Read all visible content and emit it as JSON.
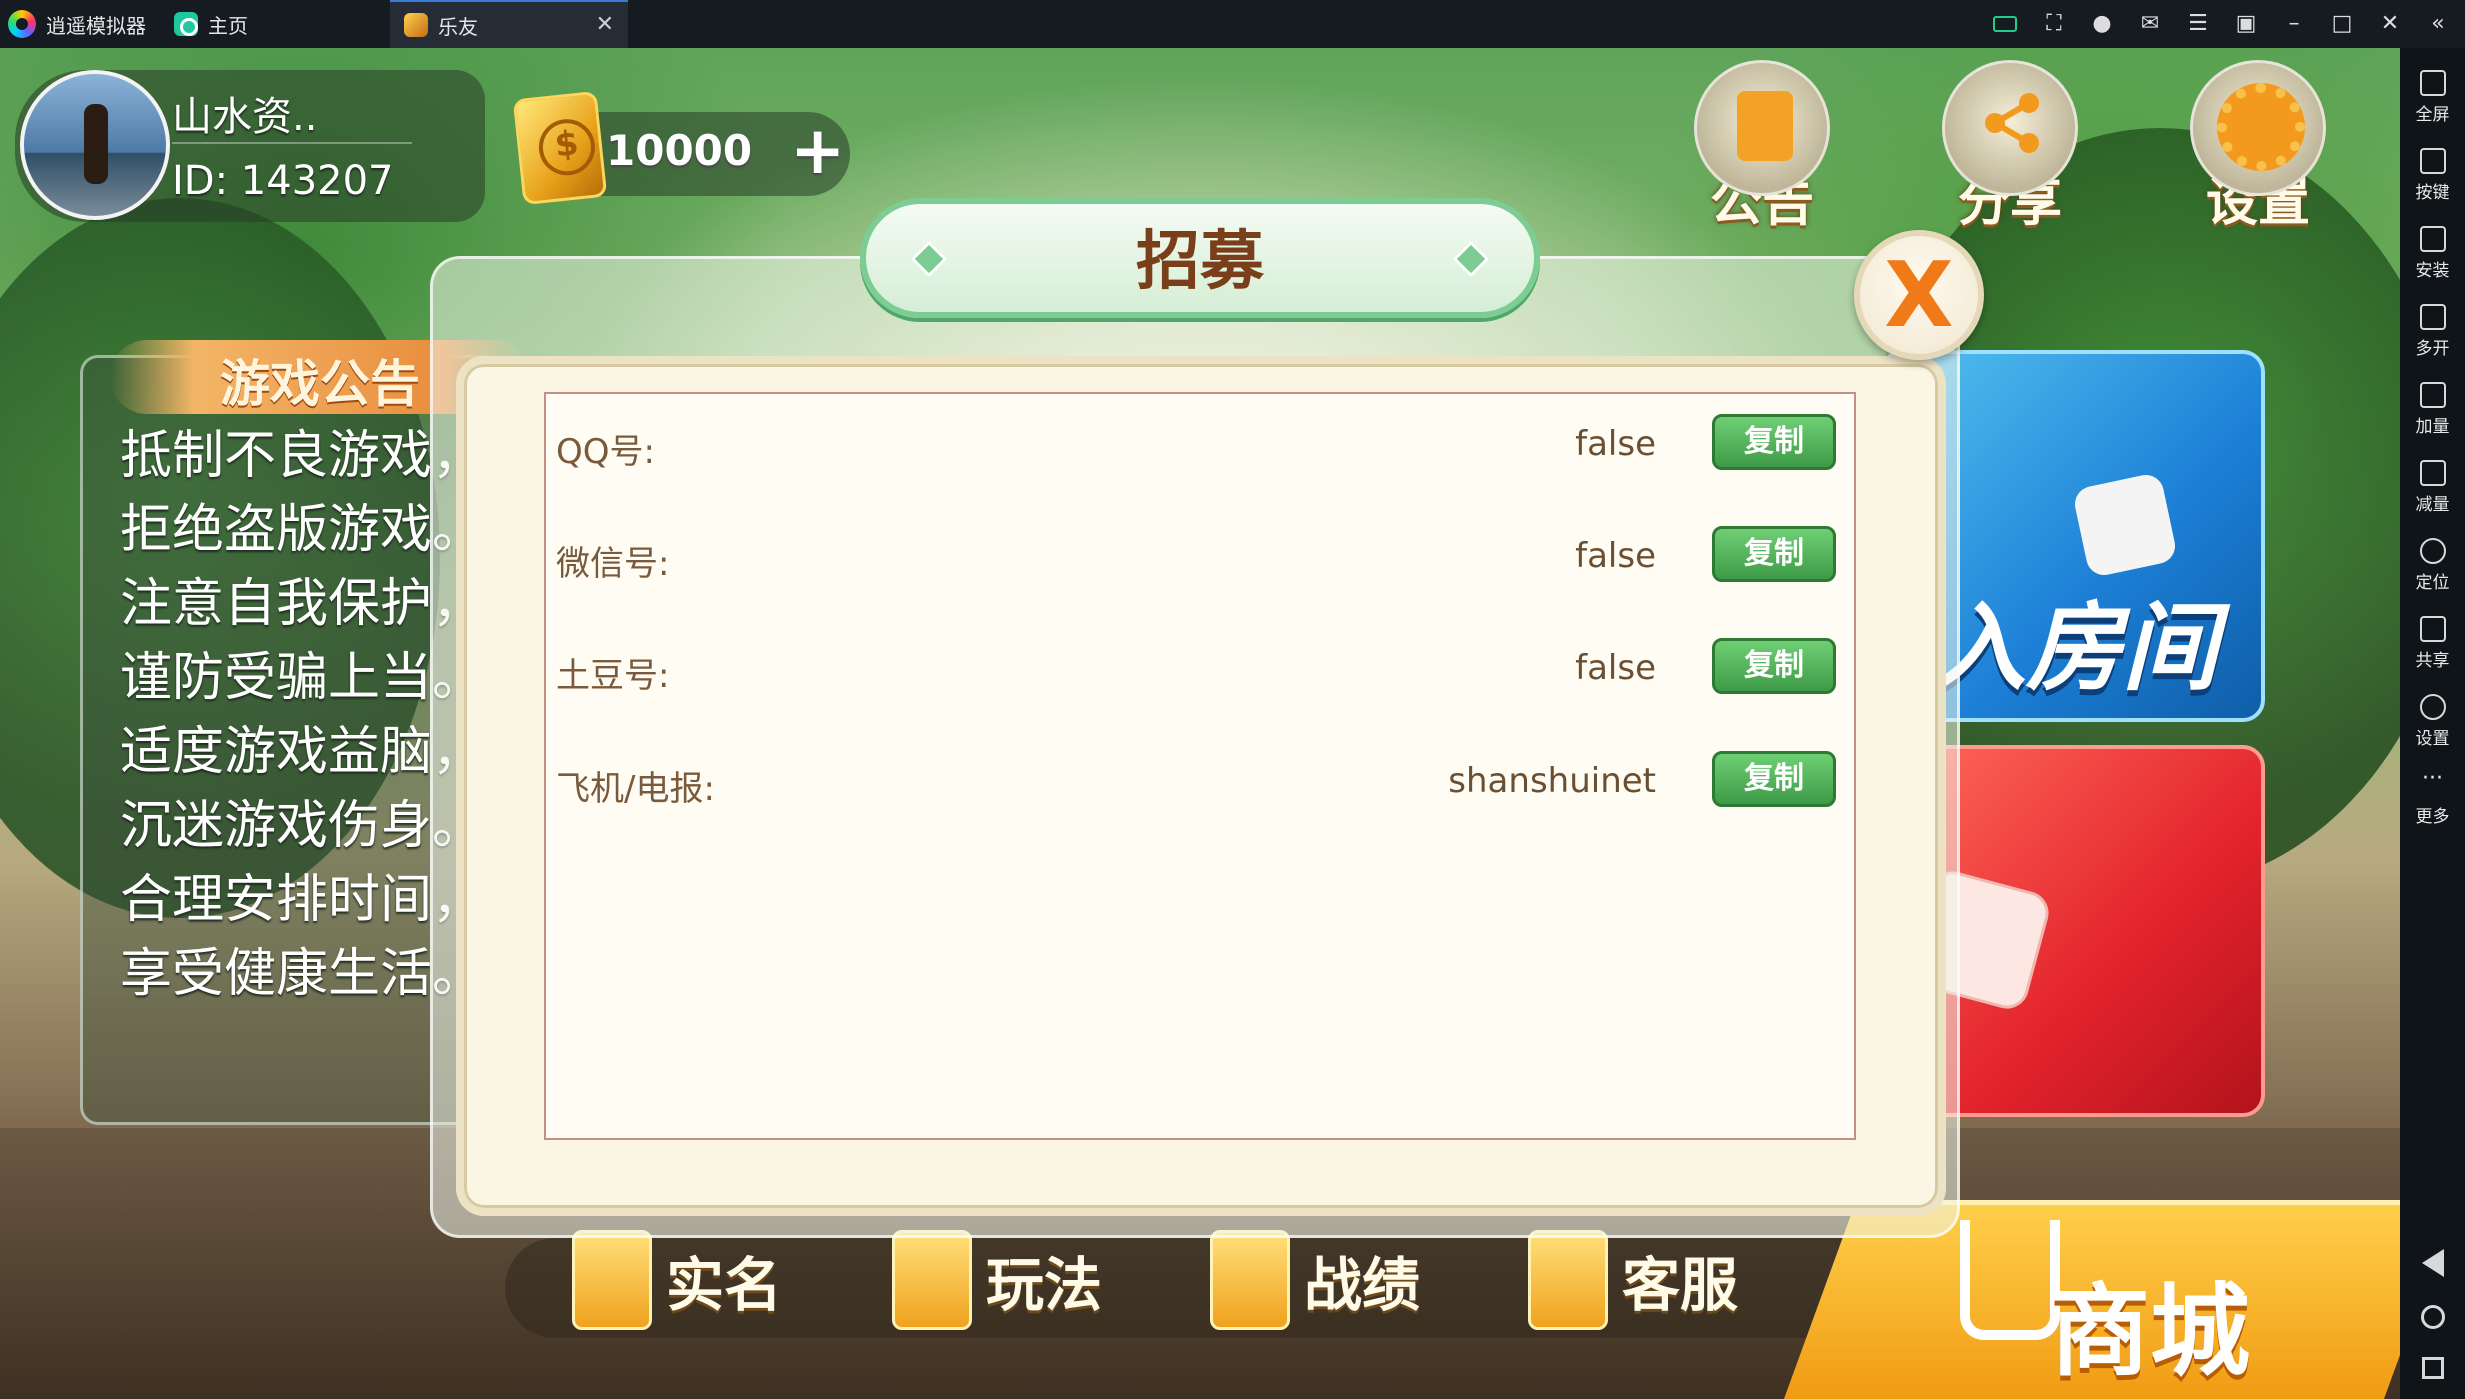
{
  "emulator": {
    "app_name": "逍遥模拟器",
    "tabs": [
      {
        "label": "主页"
      },
      {
        "label": "乐友"
      }
    ],
    "sidebar": [
      {
        "label": "全屏",
        "icon": "fullscreen-icon"
      },
      {
        "label": "按键",
        "icon": "keyboard-icon"
      },
      {
        "label": "安装",
        "icon": "apk-install-icon"
      },
      {
        "label": "多开",
        "icon": "multi-instance-icon"
      },
      {
        "label": "加量",
        "icon": "volume-up-icon"
      },
      {
        "label": "减量",
        "icon": "volume-down-icon"
      },
      {
        "label": "定位",
        "icon": "location-icon"
      },
      {
        "label": "共享",
        "icon": "folder-icon"
      },
      {
        "label": "设置",
        "icon": "settings-gear-icon"
      },
      {
        "label": "更多",
        "icon": "more-dots-icon"
      }
    ]
  },
  "profile": {
    "username": "山水资..",
    "id_text": "ID: 143207"
  },
  "coins": {
    "value": "10000",
    "add_symbol": "+"
  },
  "top_icons": {
    "notice": "公告",
    "share": "分享",
    "settings": "设置"
  },
  "board": {
    "title": "游戏公告",
    "lines": [
      "抵制不良游戏，",
      "拒绝盗版游戏。",
      "注意自我保护，",
      "谨防受骗上当。",
      "适度游戏益脑，",
      "沉迷游戏伤身。",
      "合理安排时间，",
      "享受健康生活。"
    ]
  },
  "cards": {
    "join_room": "入房间"
  },
  "bottom_bar": {
    "realname": "实名",
    "rules": "玩法",
    "record": "战绩",
    "service": "客服",
    "shop": "商城"
  },
  "modal": {
    "title": "招募",
    "close_symbol": "X",
    "rows": [
      {
        "label": "QQ号:",
        "value": "false",
        "button": "复制"
      },
      {
        "label": "微信号:",
        "value": "false",
        "button": "复制"
      },
      {
        "label": "土豆号:",
        "value": "false",
        "button": "复制"
      },
      {
        "label": "飞机/电报:",
        "value": "shanshuinet",
        "button": "复制"
      }
    ]
  }
}
